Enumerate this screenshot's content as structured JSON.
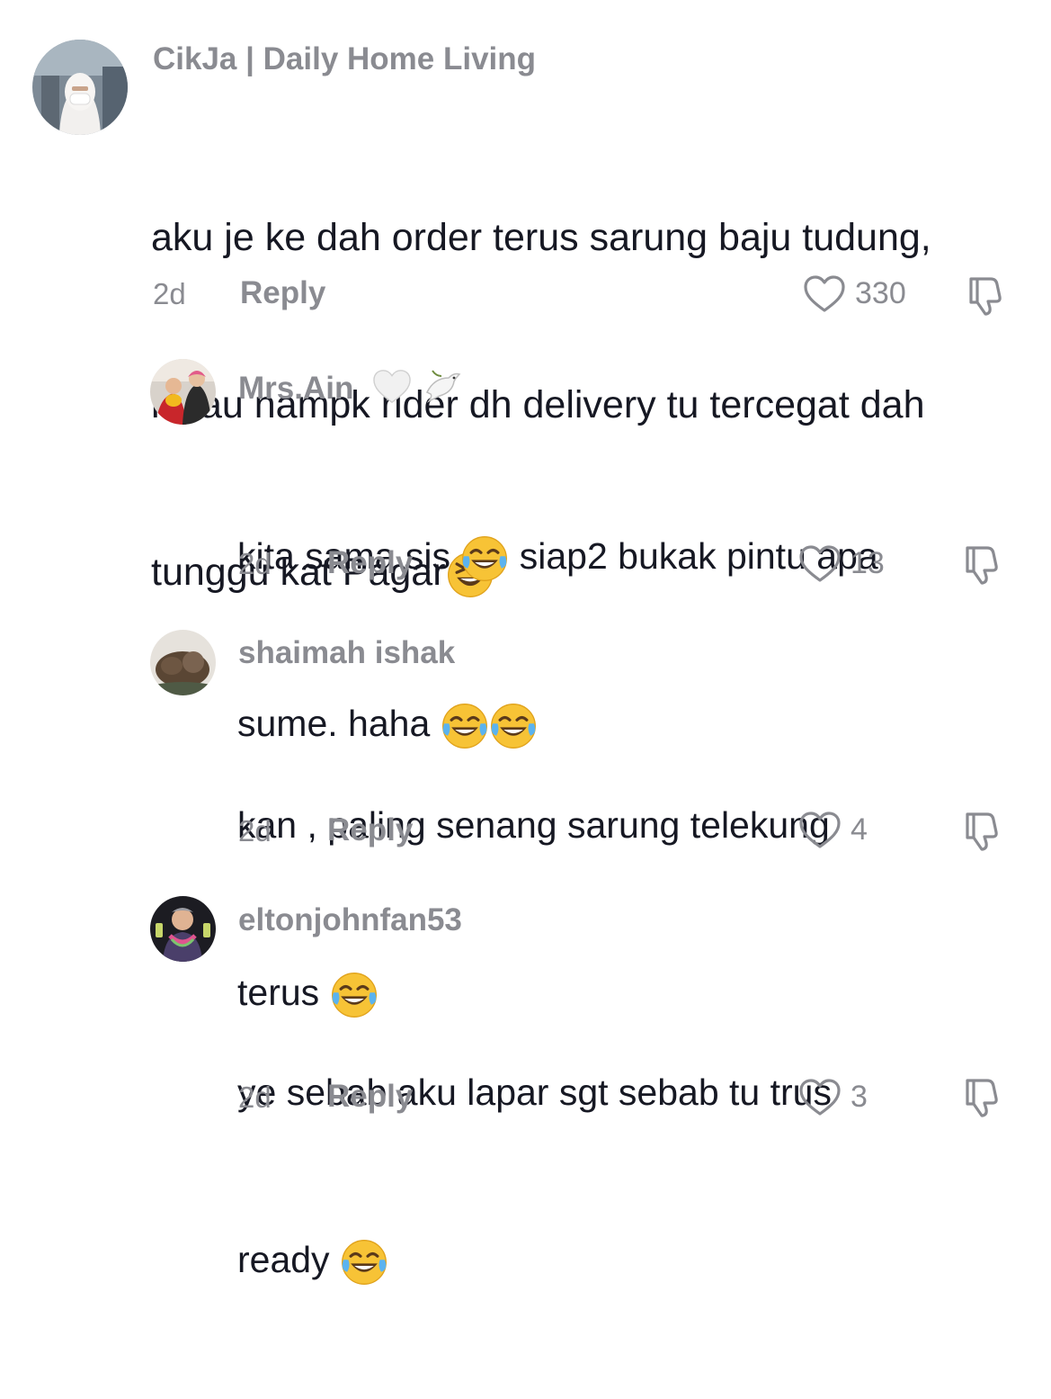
{
  "comments": [
    {
      "username": "CikJa | Daily Home Living",
      "text_lines": [
        "aku je ke dah order terus sarung baju tudung,",
        "kalau nampk rider dh delivery tu tercegat dah",
        "tunggu kat Pagar"
      ],
      "emoji": "laughing-squint",
      "time": "2d",
      "reply": "Reply",
      "likes": "330"
    },
    {
      "username": "Mrs.Ain",
      "username_emoji": "white-heart dove",
      "text_line1a": "kita sama sis",
      "text_line1b": "siap2 bukak pintu apa",
      "text_line2": "sume. haha",
      "time": "2d",
      "reply": "Reply",
      "likes": "13"
    },
    {
      "username": "shaimah ishak",
      "text_line1": "kan , paling senang sarung telekung",
      "text_line2": "terus",
      "time": "2d",
      "reply": "Reply",
      "likes": "4"
    },
    {
      "username": "eltonjohnfan53",
      "text_line1": "ye sebab aku lapar sgt sebab tu trus",
      "text_line2": "ready",
      "time": "2d",
      "reply": "Reply",
      "likes": "3"
    }
  ],
  "colors": {
    "text": "#161823",
    "muted": "#8a8b91",
    "emoji_yellow": "#f7c336"
  }
}
